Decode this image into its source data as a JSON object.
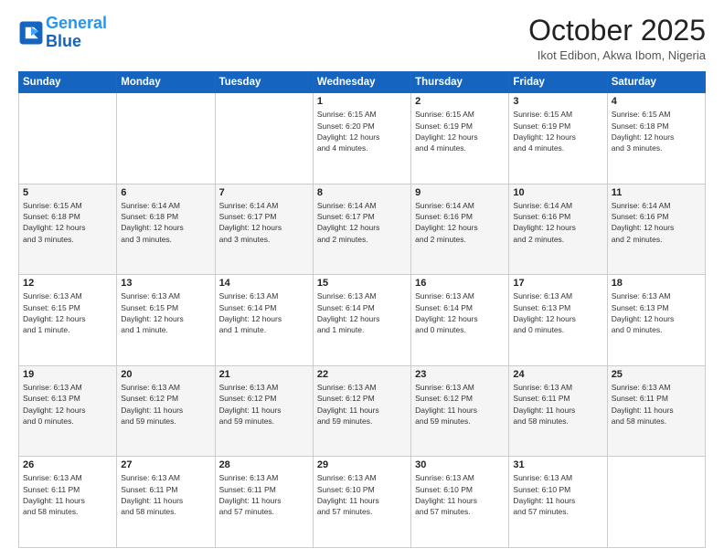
{
  "header": {
    "logo_line1": "General",
    "logo_line2": "Blue",
    "month": "October 2025",
    "location": "Ikot Edibon, Akwa Ibom, Nigeria"
  },
  "weekdays": [
    "Sunday",
    "Monday",
    "Tuesday",
    "Wednesday",
    "Thursday",
    "Friday",
    "Saturday"
  ],
  "weeks": [
    [
      {
        "day": "",
        "info": ""
      },
      {
        "day": "",
        "info": ""
      },
      {
        "day": "",
        "info": ""
      },
      {
        "day": "1",
        "info": "Sunrise: 6:15 AM\nSunset: 6:20 PM\nDaylight: 12 hours\nand 4 minutes."
      },
      {
        "day": "2",
        "info": "Sunrise: 6:15 AM\nSunset: 6:19 PM\nDaylight: 12 hours\nand 4 minutes."
      },
      {
        "day": "3",
        "info": "Sunrise: 6:15 AM\nSunset: 6:19 PM\nDaylight: 12 hours\nand 4 minutes."
      },
      {
        "day": "4",
        "info": "Sunrise: 6:15 AM\nSunset: 6:18 PM\nDaylight: 12 hours\nand 3 minutes."
      }
    ],
    [
      {
        "day": "5",
        "info": "Sunrise: 6:15 AM\nSunset: 6:18 PM\nDaylight: 12 hours\nand 3 minutes."
      },
      {
        "day": "6",
        "info": "Sunrise: 6:14 AM\nSunset: 6:18 PM\nDaylight: 12 hours\nand 3 minutes."
      },
      {
        "day": "7",
        "info": "Sunrise: 6:14 AM\nSunset: 6:17 PM\nDaylight: 12 hours\nand 3 minutes."
      },
      {
        "day": "8",
        "info": "Sunrise: 6:14 AM\nSunset: 6:17 PM\nDaylight: 12 hours\nand 2 minutes."
      },
      {
        "day": "9",
        "info": "Sunrise: 6:14 AM\nSunset: 6:16 PM\nDaylight: 12 hours\nand 2 minutes."
      },
      {
        "day": "10",
        "info": "Sunrise: 6:14 AM\nSunset: 6:16 PM\nDaylight: 12 hours\nand 2 minutes."
      },
      {
        "day": "11",
        "info": "Sunrise: 6:14 AM\nSunset: 6:16 PM\nDaylight: 12 hours\nand 2 minutes."
      }
    ],
    [
      {
        "day": "12",
        "info": "Sunrise: 6:13 AM\nSunset: 6:15 PM\nDaylight: 12 hours\nand 1 minute."
      },
      {
        "day": "13",
        "info": "Sunrise: 6:13 AM\nSunset: 6:15 PM\nDaylight: 12 hours\nand 1 minute."
      },
      {
        "day": "14",
        "info": "Sunrise: 6:13 AM\nSunset: 6:14 PM\nDaylight: 12 hours\nand 1 minute."
      },
      {
        "day": "15",
        "info": "Sunrise: 6:13 AM\nSunset: 6:14 PM\nDaylight: 12 hours\nand 1 minute."
      },
      {
        "day": "16",
        "info": "Sunrise: 6:13 AM\nSunset: 6:14 PM\nDaylight: 12 hours\nand 0 minutes."
      },
      {
        "day": "17",
        "info": "Sunrise: 6:13 AM\nSunset: 6:13 PM\nDaylight: 12 hours\nand 0 minutes."
      },
      {
        "day": "18",
        "info": "Sunrise: 6:13 AM\nSunset: 6:13 PM\nDaylight: 12 hours\nand 0 minutes."
      }
    ],
    [
      {
        "day": "19",
        "info": "Sunrise: 6:13 AM\nSunset: 6:13 PM\nDaylight: 12 hours\nand 0 minutes."
      },
      {
        "day": "20",
        "info": "Sunrise: 6:13 AM\nSunset: 6:12 PM\nDaylight: 11 hours\nand 59 minutes."
      },
      {
        "day": "21",
        "info": "Sunrise: 6:13 AM\nSunset: 6:12 PM\nDaylight: 11 hours\nand 59 minutes."
      },
      {
        "day": "22",
        "info": "Sunrise: 6:13 AM\nSunset: 6:12 PM\nDaylight: 11 hours\nand 59 minutes."
      },
      {
        "day": "23",
        "info": "Sunrise: 6:13 AM\nSunset: 6:12 PM\nDaylight: 11 hours\nand 59 minutes."
      },
      {
        "day": "24",
        "info": "Sunrise: 6:13 AM\nSunset: 6:11 PM\nDaylight: 11 hours\nand 58 minutes."
      },
      {
        "day": "25",
        "info": "Sunrise: 6:13 AM\nSunset: 6:11 PM\nDaylight: 11 hours\nand 58 minutes."
      }
    ],
    [
      {
        "day": "26",
        "info": "Sunrise: 6:13 AM\nSunset: 6:11 PM\nDaylight: 11 hours\nand 58 minutes."
      },
      {
        "day": "27",
        "info": "Sunrise: 6:13 AM\nSunset: 6:11 PM\nDaylight: 11 hours\nand 58 minutes."
      },
      {
        "day": "28",
        "info": "Sunrise: 6:13 AM\nSunset: 6:11 PM\nDaylight: 11 hours\nand 57 minutes."
      },
      {
        "day": "29",
        "info": "Sunrise: 6:13 AM\nSunset: 6:10 PM\nDaylight: 11 hours\nand 57 minutes."
      },
      {
        "day": "30",
        "info": "Sunrise: 6:13 AM\nSunset: 6:10 PM\nDaylight: 11 hours\nand 57 minutes."
      },
      {
        "day": "31",
        "info": "Sunrise: 6:13 AM\nSunset: 6:10 PM\nDaylight: 11 hours\nand 57 minutes."
      },
      {
        "day": "",
        "info": ""
      }
    ]
  ]
}
